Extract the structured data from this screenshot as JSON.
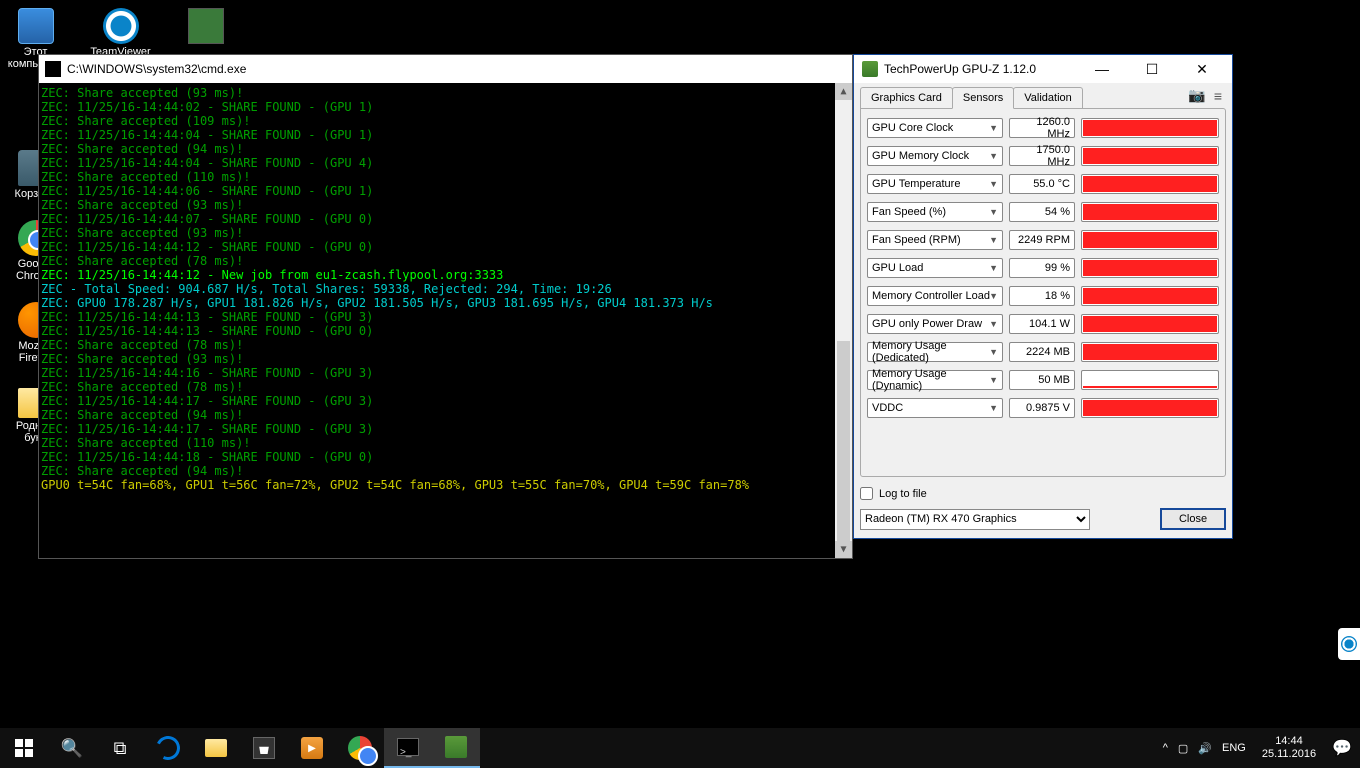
{
  "desktop": {
    "icons": [
      {
        "label": "Этот компьютер"
      },
      {
        "label": "TeamViewer"
      },
      {
        "label": ""
      },
      {
        "label": "Корзина"
      },
      {
        "label": "Google Chrome"
      },
      {
        "label": "Mozilla Firefox"
      },
      {
        "label": "Родные буки"
      }
    ]
  },
  "cmd": {
    "title": "C:\\WINDOWS\\system32\\cmd.exe",
    "lines": [
      {
        "c": "g",
        "t": "ZEC: Share accepted (93 ms)!"
      },
      {
        "c": "g",
        "t": "ZEC: 11/25/16-14:44:02 - SHARE FOUND - (GPU 1)"
      },
      {
        "c": "g",
        "t": "ZEC: Share accepted (109 ms)!"
      },
      {
        "c": "g",
        "t": "ZEC: 11/25/16-14:44:04 - SHARE FOUND - (GPU 1)"
      },
      {
        "c": "g",
        "t": "ZEC: Share accepted (94 ms)!"
      },
      {
        "c": "g",
        "t": "ZEC: 11/25/16-14:44:04 - SHARE FOUND - (GPU 4)"
      },
      {
        "c": "g",
        "t": "ZEC: Share accepted (110 ms)!"
      },
      {
        "c": "g",
        "t": "ZEC: 11/25/16-14:44:06 - SHARE FOUND - (GPU 1)"
      },
      {
        "c": "g",
        "t": "ZEC: Share accepted (93 ms)!"
      },
      {
        "c": "g",
        "t": "ZEC: 11/25/16-14:44:07 - SHARE FOUND - (GPU 0)"
      },
      {
        "c": "g",
        "t": "ZEC: Share accepted (93 ms)!"
      },
      {
        "c": "g",
        "t": "ZEC: 11/25/16-14:44:12 - SHARE FOUND - (GPU 0)"
      },
      {
        "c": "g",
        "t": "ZEC: Share accepted (78 ms)!"
      },
      {
        "c": "b",
        "t": "ZEC: 11/25/16-14:44:12 - New job from eu1-zcash.flypool.org:3333"
      },
      {
        "c": "c",
        "t": "ZEC - Total Speed: 904.687 H/s, Total Shares: 59338, Rejected: 294, Time: 19:26"
      },
      {
        "c": "c",
        "t": "ZEC: GPU0 178.287 H/s, GPU1 181.826 H/s, GPU2 181.505 H/s, GPU3 181.695 H/s, GPU4 181.373 H/s"
      },
      {
        "c": "g",
        "t": "ZEC: 11/25/16-14:44:13 - SHARE FOUND - (GPU 3)"
      },
      {
        "c": "g",
        "t": "ZEC: 11/25/16-14:44:13 - SHARE FOUND - (GPU 0)"
      },
      {
        "c": "g",
        "t": "ZEC: Share accepted (78 ms)!"
      },
      {
        "c": "g",
        "t": "ZEC: Share accepted (93 ms)!"
      },
      {
        "c": "g",
        "t": "ZEC: 11/25/16-14:44:16 - SHARE FOUND - (GPU 3)"
      },
      {
        "c": "g",
        "t": "ZEC: Share accepted (78 ms)!"
      },
      {
        "c": "g",
        "t": "ZEC: 11/25/16-14:44:17 - SHARE FOUND - (GPU 3)"
      },
      {
        "c": "g",
        "t": "ZEC: Share accepted (94 ms)!"
      },
      {
        "c": "g",
        "t": "ZEC: 11/25/16-14:44:17 - SHARE FOUND - (GPU 3)"
      },
      {
        "c": "g",
        "t": "ZEC: Share accepted (110 ms)!"
      },
      {
        "c": "g",
        "t": "ZEC: 11/25/16-14:44:18 - SHARE FOUND - (GPU 0)"
      },
      {
        "c": "g",
        "t": "ZEC: Share accepted (94 ms)!"
      },
      {
        "c": "y",
        "t": "GPU0 t=54C fan=68%, GPU1 t=56C fan=72%, GPU2 t=54C fan=68%, GPU3 t=55C fan=70%, GPU4 t=59C fan=78%"
      }
    ]
  },
  "gpuz": {
    "title": "TechPowerUp GPU-Z 1.12.0",
    "tabs": [
      "Graphics Card",
      "Sensors",
      "Validation"
    ],
    "active_tab": 1,
    "sensors": [
      {
        "label": "GPU Core Clock",
        "value": "1260.0 MHz",
        "fill": 100
      },
      {
        "label": "GPU Memory Clock",
        "value": "1750.0 MHz",
        "fill": 100
      },
      {
        "label": "GPU Temperature",
        "value": "55.0 °C",
        "fill": 100
      },
      {
        "label": "Fan Speed (%)",
        "value": "54 %",
        "fill": 100
      },
      {
        "label": "Fan Speed (RPM)",
        "value": "2249 RPM",
        "fill": 100
      },
      {
        "label": "GPU Load",
        "value": "99 %",
        "fill": 100
      },
      {
        "label": "Memory Controller Load",
        "value": "18 %",
        "fill": 100
      },
      {
        "label": "GPU only Power Draw",
        "value": "104.1 W",
        "fill": 100
      },
      {
        "label": "Memory Usage (Dedicated)",
        "value": "2224 MB",
        "fill": 100
      },
      {
        "label": "Memory Usage (Dynamic)",
        "value": "50 MB",
        "fill": 4
      },
      {
        "label": "VDDC",
        "value": "0.9875 V",
        "fill": 100
      }
    ],
    "log_label": "Log to file",
    "device": "Radeon (TM) RX 470 Graphics",
    "close": "Close"
  },
  "taskbar": {
    "lang": "ENG",
    "time": "14:44",
    "date": "25.11.2016"
  }
}
